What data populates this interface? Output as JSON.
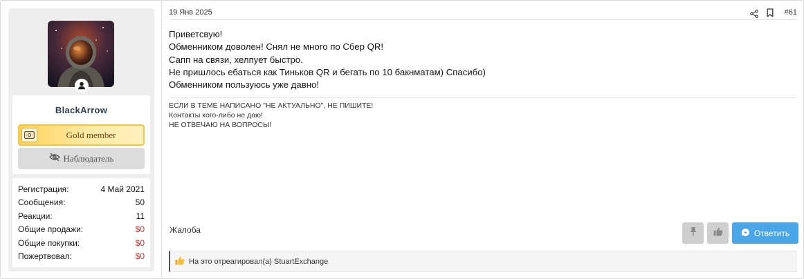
{
  "user": {
    "username": "BlackArrow",
    "rank": "Gold member",
    "watch_label": "Наблюдатель"
  },
  "stats": [
    {
      "label": "Регистрация:",
      "value": "4 Май 2021",
      "red": false
    },
    {
      "label": "Сообщения:",
      "value": "50",
      "red": false
    },
    {
      "label": "Реакции:",
      "value": "11",
      "red": false
    },
    {
      "label": "Общие продажи:",
      "value": "$0",
      "red": true
    },
    {
      "label": "Общие покупки:",
      "value": "$0",
      "red": true
    },
    {
      "label": "Пожертвовал:",
      "value": "$0",
      "red": true
    }
  ],
  "post": {
    "date": "19 Янв 2025",
    "number": "#61",
    "lines": [
      "Приветсвую!",
      "Обменником доволен! Снял не много по Сбер QR!",
      "Сапп на связи, хелпует быстро.",
      "Не пришлось ебаться как Тиньков QR и бегать по 10 бакнматам) Спасибо)",
      "Обменником пользуюсь уже давно!"
    ],
    "signature": [
      "ЕСЛИ В ТЕМЕ НАПИСАНО \"НЕ АКТУАЛЬНО\", НЕ ПИШИТЕ!",
      "Контакты кого-либо не даю!",
      "НЕ ОТВЕЧАЮ НА ВОПРОСЫ!"
    ]
  },
  "actions": {
    "report_label": "Жалоба",
    "reply_label": "Ответить"
  },
  "reactions": {
    "text": "На это отреагировал(а) StuartExchange"
  },
  "colors": {
    "accent": "#4aa6e6",
    "gold": "#f5c542",
    "negative": "#d42c2c"
  }
}
